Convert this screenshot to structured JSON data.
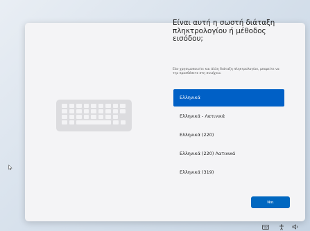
{
  "dialog": {
    "title": "Είναι αυτή η σωστή διάταξη πληκτρολογίου ή μέθοδος εισόδου;",
    "subtitle": "Εάν χρησιμοποιείτε και άλλη διάταξη πληκτρολογίου, μπορείτε να την προσθέσετε στη συνέχεια."
  },
  "layouts": [
    {
      "label": "Ελληνικά",
      "selected": true
    },
    {
      "label": "Ελληνικά - Λατινικά",
      "selected": false
    },
    {
      "label": "Ελληνικά (220)",
      "selected": false
    },
    {
      "label": "Ελληνικά (220) Λατινικά",
      "selected": false
    },
    {
      "label": "Ελληνικά (319)",
      "selected": false
    }
  ],
  "buttons": {
    "next_label": "Ναι"
  },
  "taskbar": {
    "icons": [
      "keyboard-icon",
      "accessibility-icon",
      "volume-icon"
    ]
  },
  "colors": {
    "accent": "#0067c0",
    "selected_bg": "#0060c6"
  }
}
